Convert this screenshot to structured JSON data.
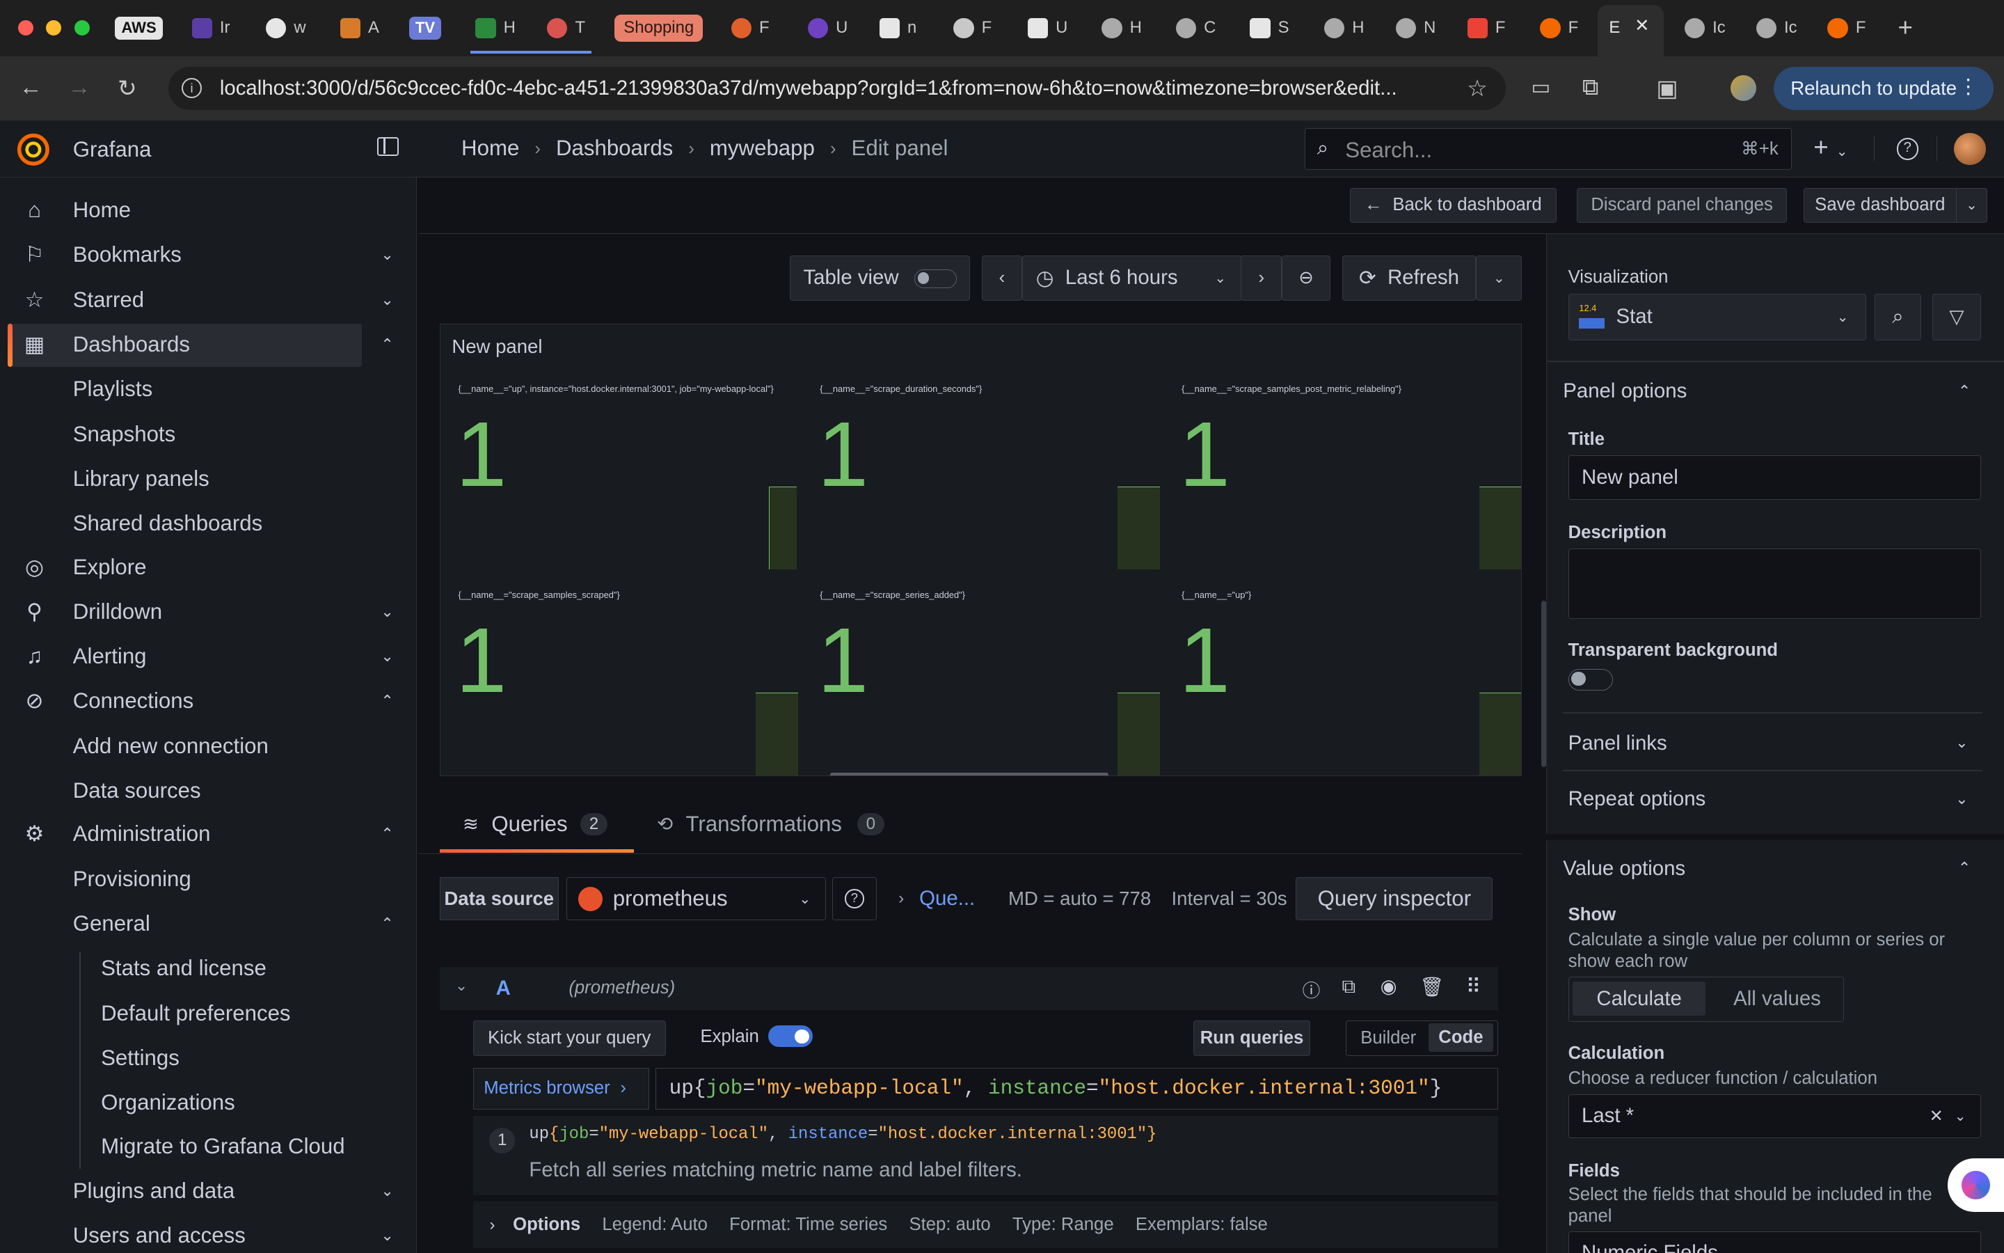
{
  "browser": {
    "tabs": [
      {
        "label": "AWS",
        "color": "#e5e5e5"
      },
      {
        "label": "Ir",
        "color": "#5a3ea6"
      },
      {
        "label": "w",
        "color": "#e6e6e6"
      },
      {
        "label": "A",
        "color": "#d77b2b"
      },
      {
        "label": "TV",
        "color": "#6b7bd6"
      },
      {
        "label": "H",
        "color": "#2b8a3e"
      },
      {
        "label": "T",
        "color": "#d9534f"
      },
      {
        "label": "Shopping",
        "color": "#e8806b"
      },
      {
        "label": "F",
        "color": "#e0602c"
      },
      {
        "label": "U",
        "color": "#6f42c1"
      },
      {
        "label": "n",
        "color": "#e6e6e6"
      },
      {
        "label": "F",
        "color": "#c8c8c8"
      },
      {
        "label": "U",
        "color": "#e6e6e6"
      },
      {
        "label": "H",
        "color": "#aaaaaa"
      },
      {
        "label": "C",
        "color": "#aaaaaa"
      },
      {
        "label": "S",
        "color": "#e6e6e6"
      },
      {
        "label": "H",
        "color": "#aaaaaa"
      },
      {
        "label": "N",
        "color": "#aaaaaa"
      },
      {
        "label": "F",
        "color": "#ea4335"
      },
      {
        "label": "F",
        "color": "#f46800"
      },
      {
        "label": "E",
        "color": "#f46800"
      },
      {
        "label": "Ic",
        "color": "#aaaaaa"
      },
      {
        "label": "Ic",
        "color": "#aaaaaa"
      },
      {
        "label": "F",
        "color": "#f46800"
      }
    ],
    "url": "localhost:3000/d/56c9ccec-fd0c-4ebc-a451-21399830a37d/mywebapp?orgId=1&from=now-6h&to=now&timezone=browser&edit...",
    "relaunch_label": "Relaunch to update"
  },
  "grafana": {
    "brand": "Grafana",
    "breadcrumb": [
      "Home",
      "Dashboards",
      "mywebapp",
      "Edit panel"
    ],
    "search_placeholder": "Search...",
    "search_shortcut": "⌘+k"
  },
  "sidebar": {
    "items": [
      {
        "label": "Home",
        "icon": "home-icon"
      },
      {
        "label": "Bookmarks",
        "icon": "bookmark-icon"
      },
      {
        "label": "Starred",
        "icon": "star-icon"
      },
      {
        "label": "Dashboards",
        "icon": "apps-icon"
      },
      {
        "label": "Playlists"
      },
      {
        "label": "Snapshots"
      },
      {
        "label": "Library panels"
      },
      {
        "label": "Shared dashboards"
      },
      {
        "label": "Explore",
        "icon": "compass-icon"
      },
      {
        "label": "Drilldown",
        "icon": "drilldown-icon"
      },
      {
        "label": "Alerting",
        "icon": "bell-icon"
      },
      {
        "label": "Connections",
        "icon": "connections-icon"
      },
      {
        "label": "Add new connection"
      },
      {
        "label": "Data sources"
      },
      {
        "label": "Administration",
        "icon": "cog-icon"
      },
      {
        "label": "Provisioning"
      },
      {
        "label": "General"
      },
      {
        "label": "Stats and license"
      },
      {
        "label": "Default preferences"
      },
      {
        "label": "Settings"
      },
      {
        "label": "Organizations"
      },
      {
        "label": "Migrate to Grafana Cloud"
      },
      {
        "label": "Plugins and data"
      },
      {
        "label": "Users and access"
      }
    ]
  },
  "edit_toolbar": {
    "back": "Back to dashboard",
    "discard": "Discard panel changes",
    "save": "Save dashboard"
  },
  "panel_toolbar": {
    "table_view": "Table view",
    "time_range": "Last 6 hours",
    "refresh": "Refresh"
  },
  "panel": {
    "title": "New panel",
    "stats": [
      {
        "label": "{__name__=\"up\", instance=\"host.docker.internal:3001\", job=\"my-webapp-local\"}",
        "value": "1"
      },
      {
        "label": "{__name__=\"scrape_duration_seconds\"}",
        "value": "1"
      },
      {
        "label": "{__name__=\"scrape_samples_post_metric_relabeling\"}",
        "value": "1"
      },
      {
        "label": "{__name__=\"scrape_samples_scraped\"}",
        "value": "1"
      },
      {
        "label": "{__name__=\"scrape_series_added\"}",
        "value": "1"
      },
      {
        "label": "{__name__=\"up\"}",
        "value": "1"
      }
    ]
  },
  "queries": {
    "tab_queries": "Queries",
    "tab_queries_count": "2",
    "tab_transformations": "Transformations",
    "tab_transformations_count": "0",
    "datasource_label": "Data source",
    "datasource": "prometheus",
    "query_options_short": "Que...",
    "md": "MD = auto = 778",
    "interval": "Interval = 30s",
    "inspector": "Query inspector",
    "query_ref": "A",
    "query_ds": "(prometheus)",
    "kickstart": "Kick start your query",
    "explain": "Explain",
    "run": "Run queries",
    "builder": "Builder",
    "code": "Code",
    "metrics_browser": "Metrics browser",
    "expr_metric": "up",
    "expr_job_key": "job",
    "expr_job_val": "\"my-webapp-local\"",
    "expr_inst_key": "instance",
    "expr_inst_val": "\"host.docker.internal:3001\"",
    "line_no": "1",
    "hint": "Fetch all series matching metric name and label filters.",
    "options_label": "Options",
    "legend": "Legend: Auto",
    "format": "Format: Time series",
    "step": "Step: auto",
    "type": "Type: Range",
    "exemplars": "Exemplars: false"
  },
  "options_pane": {
    "visualization_label": "Visualization",
    "visualization": "Stat",
    "version_badge": "12.4",
    "panel_options": "Panel options",
    "title_label": "Title",
    "title_value": "New panel",
    "description_label": "Description",
    "transparent_label": "Transparent background",
    "panel_links": "Panel links",
    "repeat_options": "Repeat options",
    "value_options": "Value options",
    "show_label": "Show",
    "show_desc": "Calculate a single value per column or series or show each row",
    "calculate": "Calculate",
    "all_values": "All values",
    "calculation_label": "Calculation",
    "calculation_desc": "Choose a reducer function / calculation",
    "calculation_value": "Last *",
    "fields_label": "Fields",
    "fields_desc": "Select the fields that should be included in the panel",
    "fields_value": "Numeric Fields"
  },
  "colors": {
    "accent": "#3d71d9",
    "stat_green": "#73bf69",
    "grafana_orange": "#f55f3e"
  }
}
